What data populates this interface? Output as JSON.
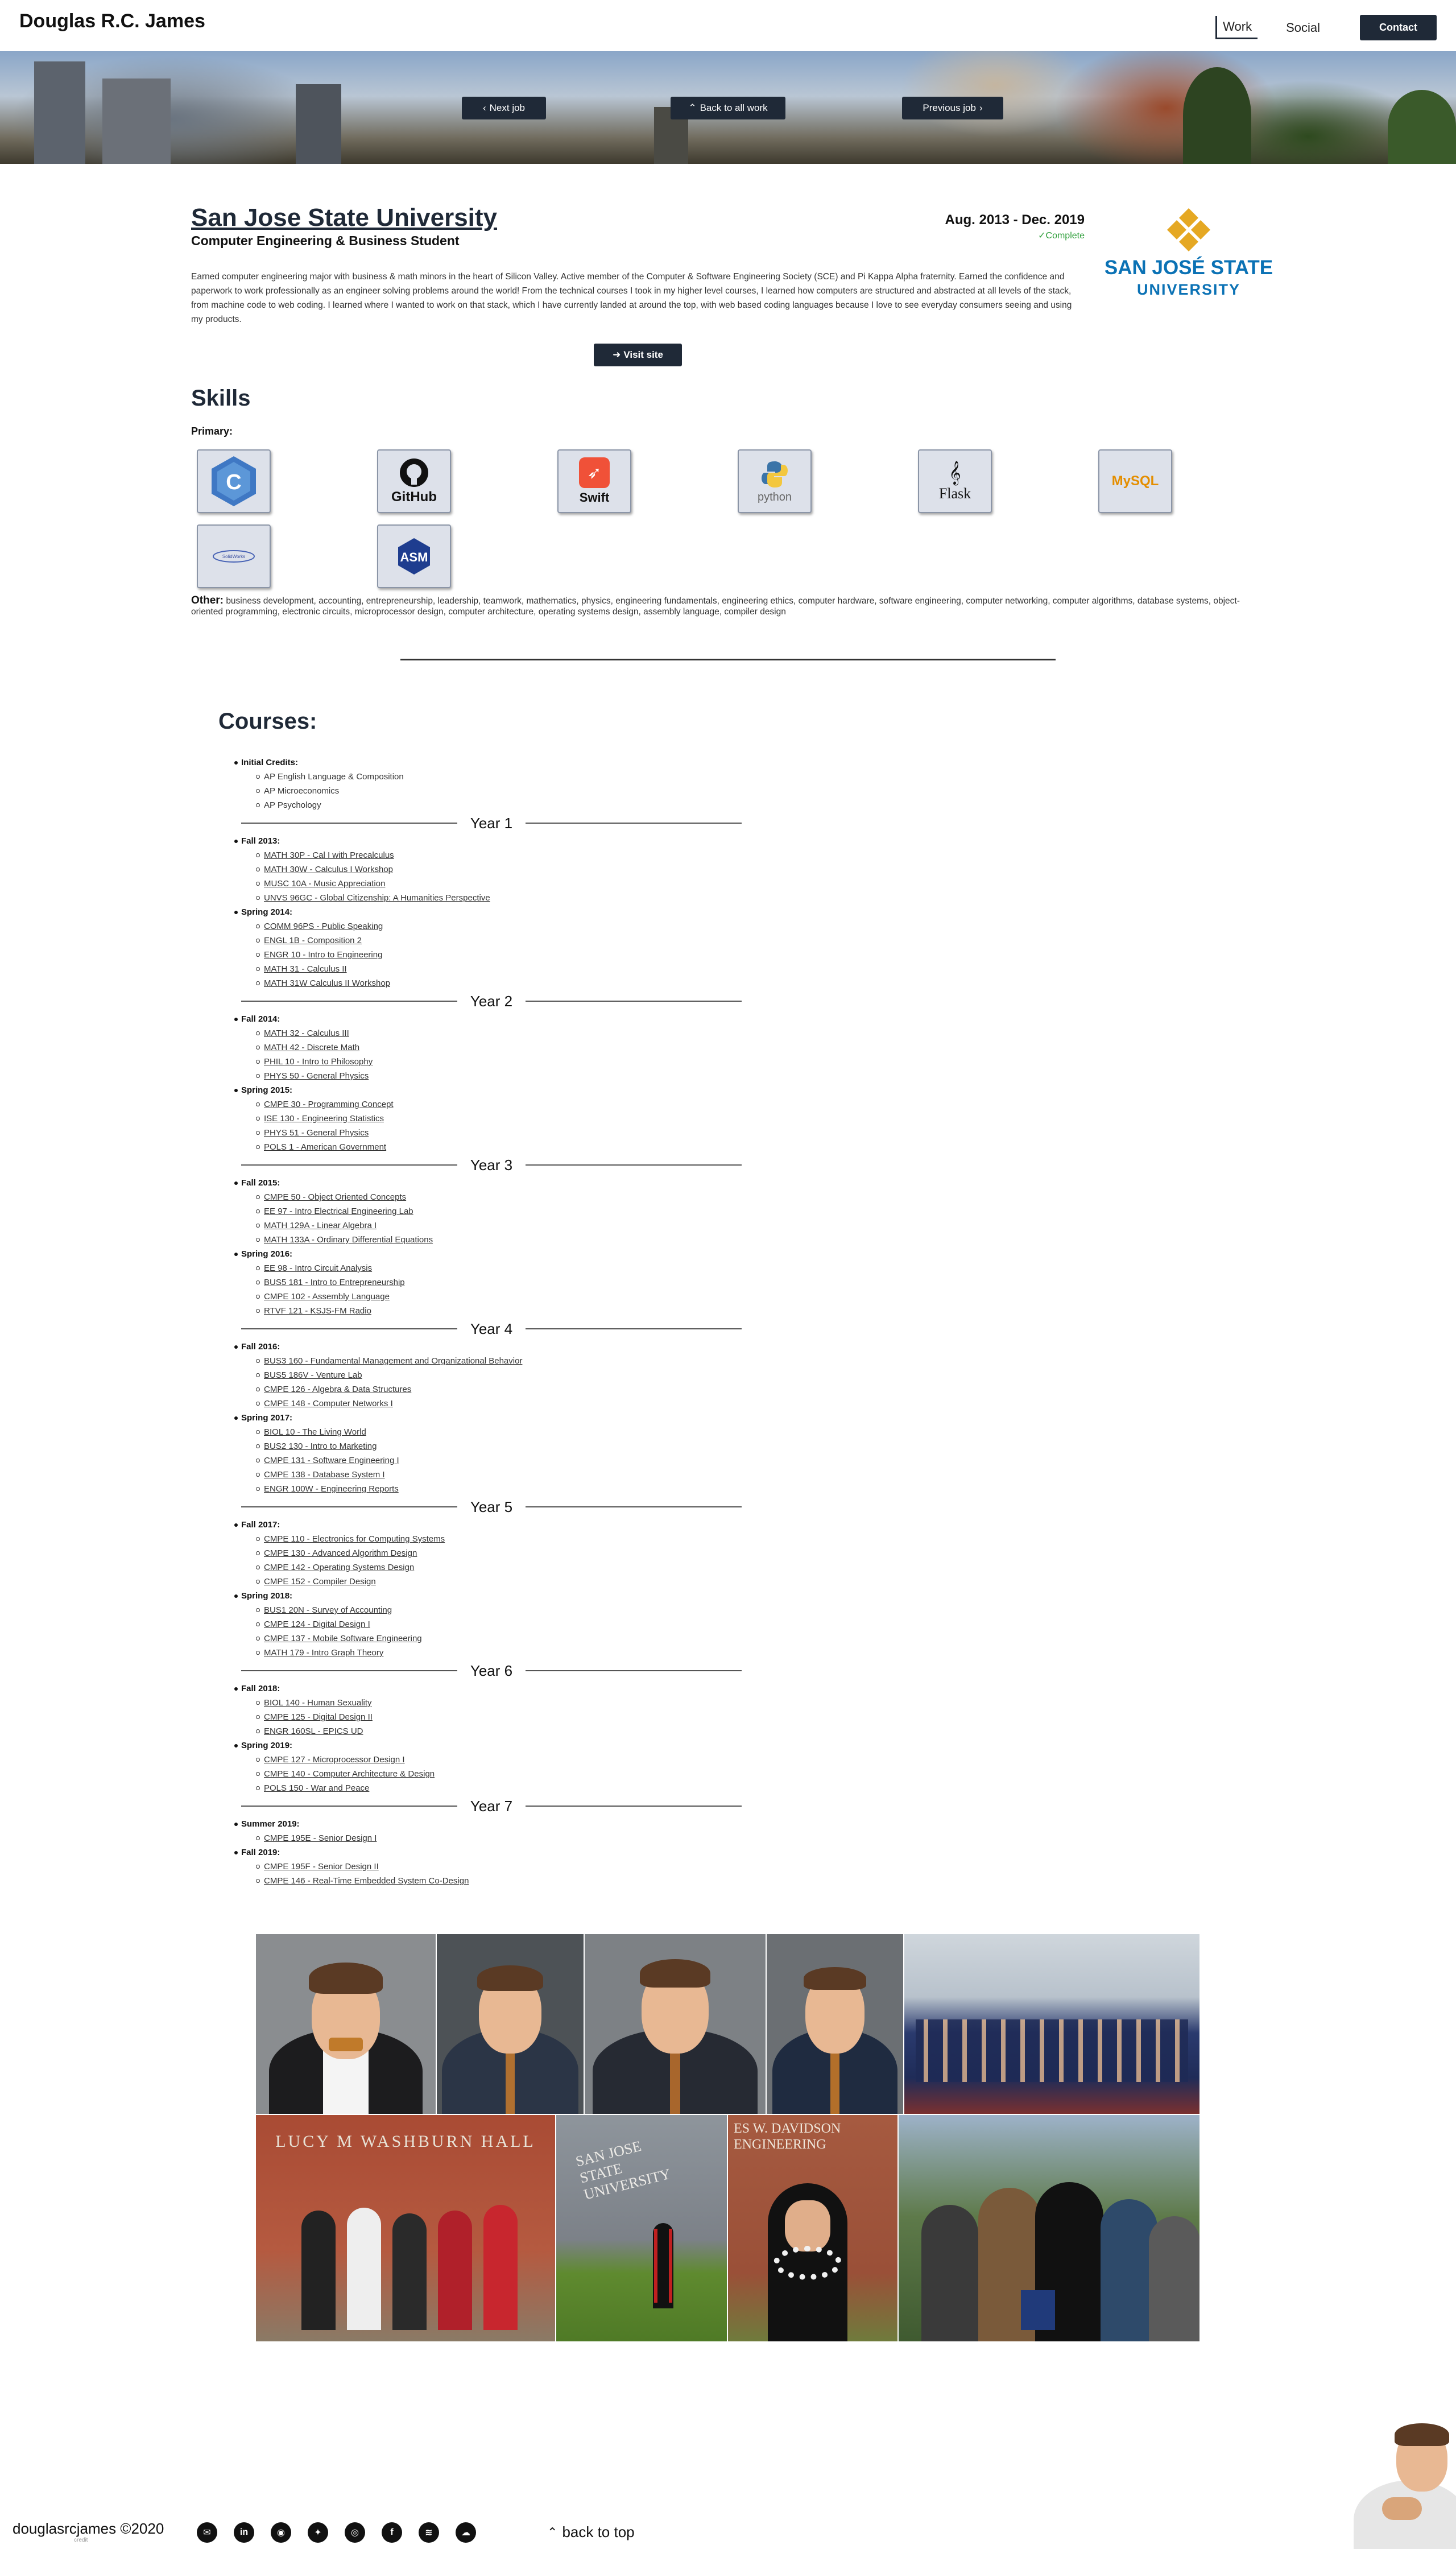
{
  "nav": {
    "brand": "Douglas R.C. James",
    "links": [
      "Work",
      "Social"
    ],
    "contact": "Contact"
  },
  "hero": {
    "next": "Next job",
    "back": "Back to all work",
    "previous": "Previous job"
  },
  "job": {
    "title": "San Jose State University",
    "subtitle": "Computer Engineering & Business Student",
    "dates": "Aug. 2013 - Dec. 2019",
    "status": "Complete",
    "description": "Earned computer engineering major with business & math minors in the heart of Silicon Valley. Active member of the Computer & Software Engineering Society (SCE) and Pi Kappa Alpha fraternity. Earned the confidence and paperwork to work professionally as an engineer solving problems around the world! From the technical courses I took in my higher level courses, I learned how computers are structured and abstracted at all levels of the stack, from machine code to web coding. I learned where I wanted to work on that stack, which I have currently landed at around the top, with web based coding languages because I love to see everyday consumers seeing and using my products.",
    "visit": "Visit site",
    "logo_line1": "SAN JOSÉ STATE",
    "logo_line2": "UNIVERSITY"
  },
  "skills": {
    "heading": "Skills",
    "primary_label": "Primary:",
    "primary": [
      {
        "name": "cplusplus-icon",
        "label": "C++"
      },
      {
        "name": "github-icon",
        "label": "GitHub"
      },
      {
        "name": "swift-icon",
        "label": "Swift"
      },
      {
        "name": "python-icon",
        "label": "python"
      },
      {
        "name": "flask-icon",
        "label": "Flask"
      },
      {
        "name": "mysql-icon",
        "label": "MySQL"
      },
      {
        "name": "solidworks-icon",
        "label": "SolidWorks"
      },
      {
        "name": "assembly-icon",
        "label": "ASM"
      }
    ],
    "other_label": "Other:",
    "other": "business development, accounting, entrepreneurship, leadership, teamwork, mathematics, physics, engineering fundamentals, engineering ethics, computer hardware, software engineering, computer networking, computer algorithms, database systems, object-oriented programming, electronic circuits, microprocessor design, computer architecture, operating systems design, assembly language, compiler design"
  },
  "courses": {
    "heading": "Courses:",
    "initial": {
      "label": "Initial Credits:",
      "items": [
        "AP English Language & Composition",
        "AP Microeconomics",
        "AP Psychology"
      ]
    },
    "years": [
      {
        "label": "Year 1",
        "terms": [
          {
            "label": "Fall 2013:",
            "items": [
              "MATH 30P - Cal I with Precalculus",
              "MATH 30W - Calculus I Workshop",
              "MUSC 10A - Music Appreciation",
              "UNVS 96GC - Global Citizenship: A Humanities Perspective"
            ]
          },
          {
            "label": "Spring 2014:",
            "items": [
              "COMM 96PS - Public Speaking",
              "ENGL 1B - Composition 2",
              "ENGR 10 - Intro to Engineering",
              "MATH 31 - Calculus II",
              "MATH 31W Calculus II Workshop"
            ]
          }
        ]
      },
      {
        "label": "Year 2",
        "terms": [
          {
            "label": "Fall 2014:",
            "items": [
              "MATH 32 - Calculus III",
              "MATH 42 - Discrete Math",
              "PHIL 10 - Intro to Philosophy",
              "PHYS 50 - General Physics"
            ]
          },
          {
            "label": "Spring 2015:",
            "items": [
              "CMPE 30 - Programming Concept",
              "ISE 130 - Engineering Statistics",
              "PHYS 51 - General Physics",
              "POLS 1 - American Government"
            ]
          }
        ]
      },
      {
        "label": "Year 3",
        "terms": [
          {
            "label": "Fall 2015:",
            "items": [
              "CMPE 50 - Object Oriented Concepts",
              "EE 97 - Intro Electrical Engineering Lab",
              "MATH 129A - Linear Algebra I",
              "MATH 133A - Ordinary Differential Equations"
            ]
          },
          {
            "label": "Spring 2016:",
            "items": [
              "EE 98 - Intro Circuit Analysis",
              "BUS5 181 - Intro to Entrepreneurship",
              "CMPE 102 - Assembly Language",
              "RTVF 121 - KSJS-FM Radio"
            ]
          }
        ]
      },
      {
        "label": "Year 4",
        "terms": [
          {
            "label": "Fall 2016:",
            "items": [
              "BUS3 160 - Fundamental Management and Organizational Behavior",
              "BUS5 186V - Venture Lab",
              "CMPE 126 - Algebra & Data Structures",
              "CMPE 148 - Computer Networks I"
            ]
          },
          {
            "label": "Spring 2017:",
            "items": [
              "BIOL 10 - The Living World",
              "BUS2 130 - Intro to Marketing",
              "CMPE 131 - Software Engineering I",
              "CMPE 138 - Database System I",
              "ENGR 100W - Engineering Reports"
            ]
          }
        ]
      },
      {
        "label": "Year 5",
        "terms": [
          {
            "label": "Fall 2017:",
            "items": [
              "CMPE 110 - Electronics for Computing Systems",
              "CMPE 130 - Advanced Algorithm Design",
              "CMPE 142 - Operating Systems Design",
              "CMPE 152 - Compiler Design"
            ]
          },
          {
            "label": "Spring 2018:",
            "items": [
              "BUS1 20N - Survey of Accounting",
              "CMPE 124 - Digital Design I",
              "CMPE 137 - Mobile Software Engineering",
              "MATH 179 - Intro Graph Theory"
            ]
          }
        ]
      },
      {
        "label": "Year 6",
        "terms": [
          {
            "label": "Fall 2018:",
            "items": [
              "BIOL 140 - Human Sexuality",
              "CMPE 125 - Digital Design II",
              "ENGR 160SL - EPICS UD"
            ]
          },
          {
            "label": "Spring 2019:",
            "items": [
              "CMPE 127 - Microprocessor Design I",
              "CMPE 140 - Computer Architecture & Design",
              "POLS 150 - War and Peace"
            ]
          }
        ]
      },
      {
        "label": "Year 7",
        "terms": [
          {
            "label": "Summer 2019:",
            "items": [
              "CMPE 195E - Senior Design I"
            ]
          },
          {
            "label": "Fall 2019:",
            "items": [
              "CMPE 195F - Senior Design II",
              "CMPE 146 - Real-Time Embedded System Co-Design"
            ]
          }
        ]
      }
    ]
  },
  "photos": {
    "hall_sign": "LUCY M WASHBURN HALL",
    "campus_sign": "SAN JOSE STATE UNIVERSITY",
    "engineering_sign": "ES W. DAVIDSON ENGINEERING"
  },
  "footer": {
    "copyright": "douglasrcjames ©2020",
    "credit": "credit",
    "back_to_top": "back to top",
    "social": [
      {
        "name": "email-icon",
        "glyph": "✉"
      },
      {
        "name": "linkedin-icon",
        "glyph": "in"
      },
      {
        "name": "github-icon",
        "glyph": "◉"
      },
      {
        "name": "twitter-icon",
        "glyph": "✦"
      },
      {
        "name": "instagram-icon",
        "glyph": "◎"
      },
      {
        "name": "facebook-icon",
        "glyph": "f"
      },
      {
        "name": "spotify-icon",
        "glyph": "≋"
      },
      {
        "name": "soundcloud-icon",
        "glyph": "☁"
      }
    ]
  },
  "colors": {
    "primary": "#1f2937",
    "complete": "#2e9e3a",
    "sjsu_blue": "#0b72b5",
    "sjsu_gold": "#e5a823"
  }
}
